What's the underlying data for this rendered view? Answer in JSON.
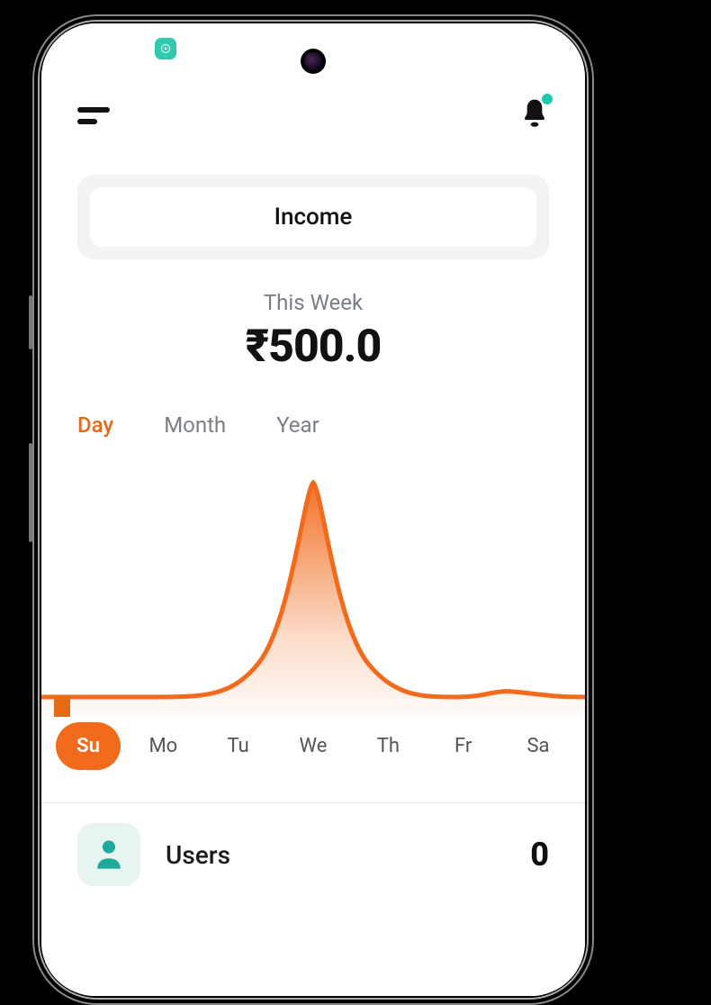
{
  "header": {
    "notifications_unread": true
  },
  "mode": {
    "label": "Income"
  },
  "summary": {
    "period_label": "This Week",
    "amount": "₹500.0"
  },
  "range_tabs": {
    "active": "Day",
    "items": [
      "Day",
      "Month",
      "Year"
    ]
  },
  "chart_data": {
    "type": "area",
    "title": "",
    "xlabel": "",
    "ylabel": "",
    "categories": [
      "Su",
      "Mo",
      "Tu",
      "We",
      "Th",
      "Fr",
      "Sa"
    ],
    "values": [
      0,
      0,
      0,
      500,
      0,
      0,
      0
    ],
    "ylim": [
      0,
      500
    ],
    "selected_category": "Su",
    "color": "#f26b1d"
  },
  "stats": {
    "rows": [
      {
        "icon": "user",
        "label": "Users",
        "value": "0"
      }
    ]
  }
}
